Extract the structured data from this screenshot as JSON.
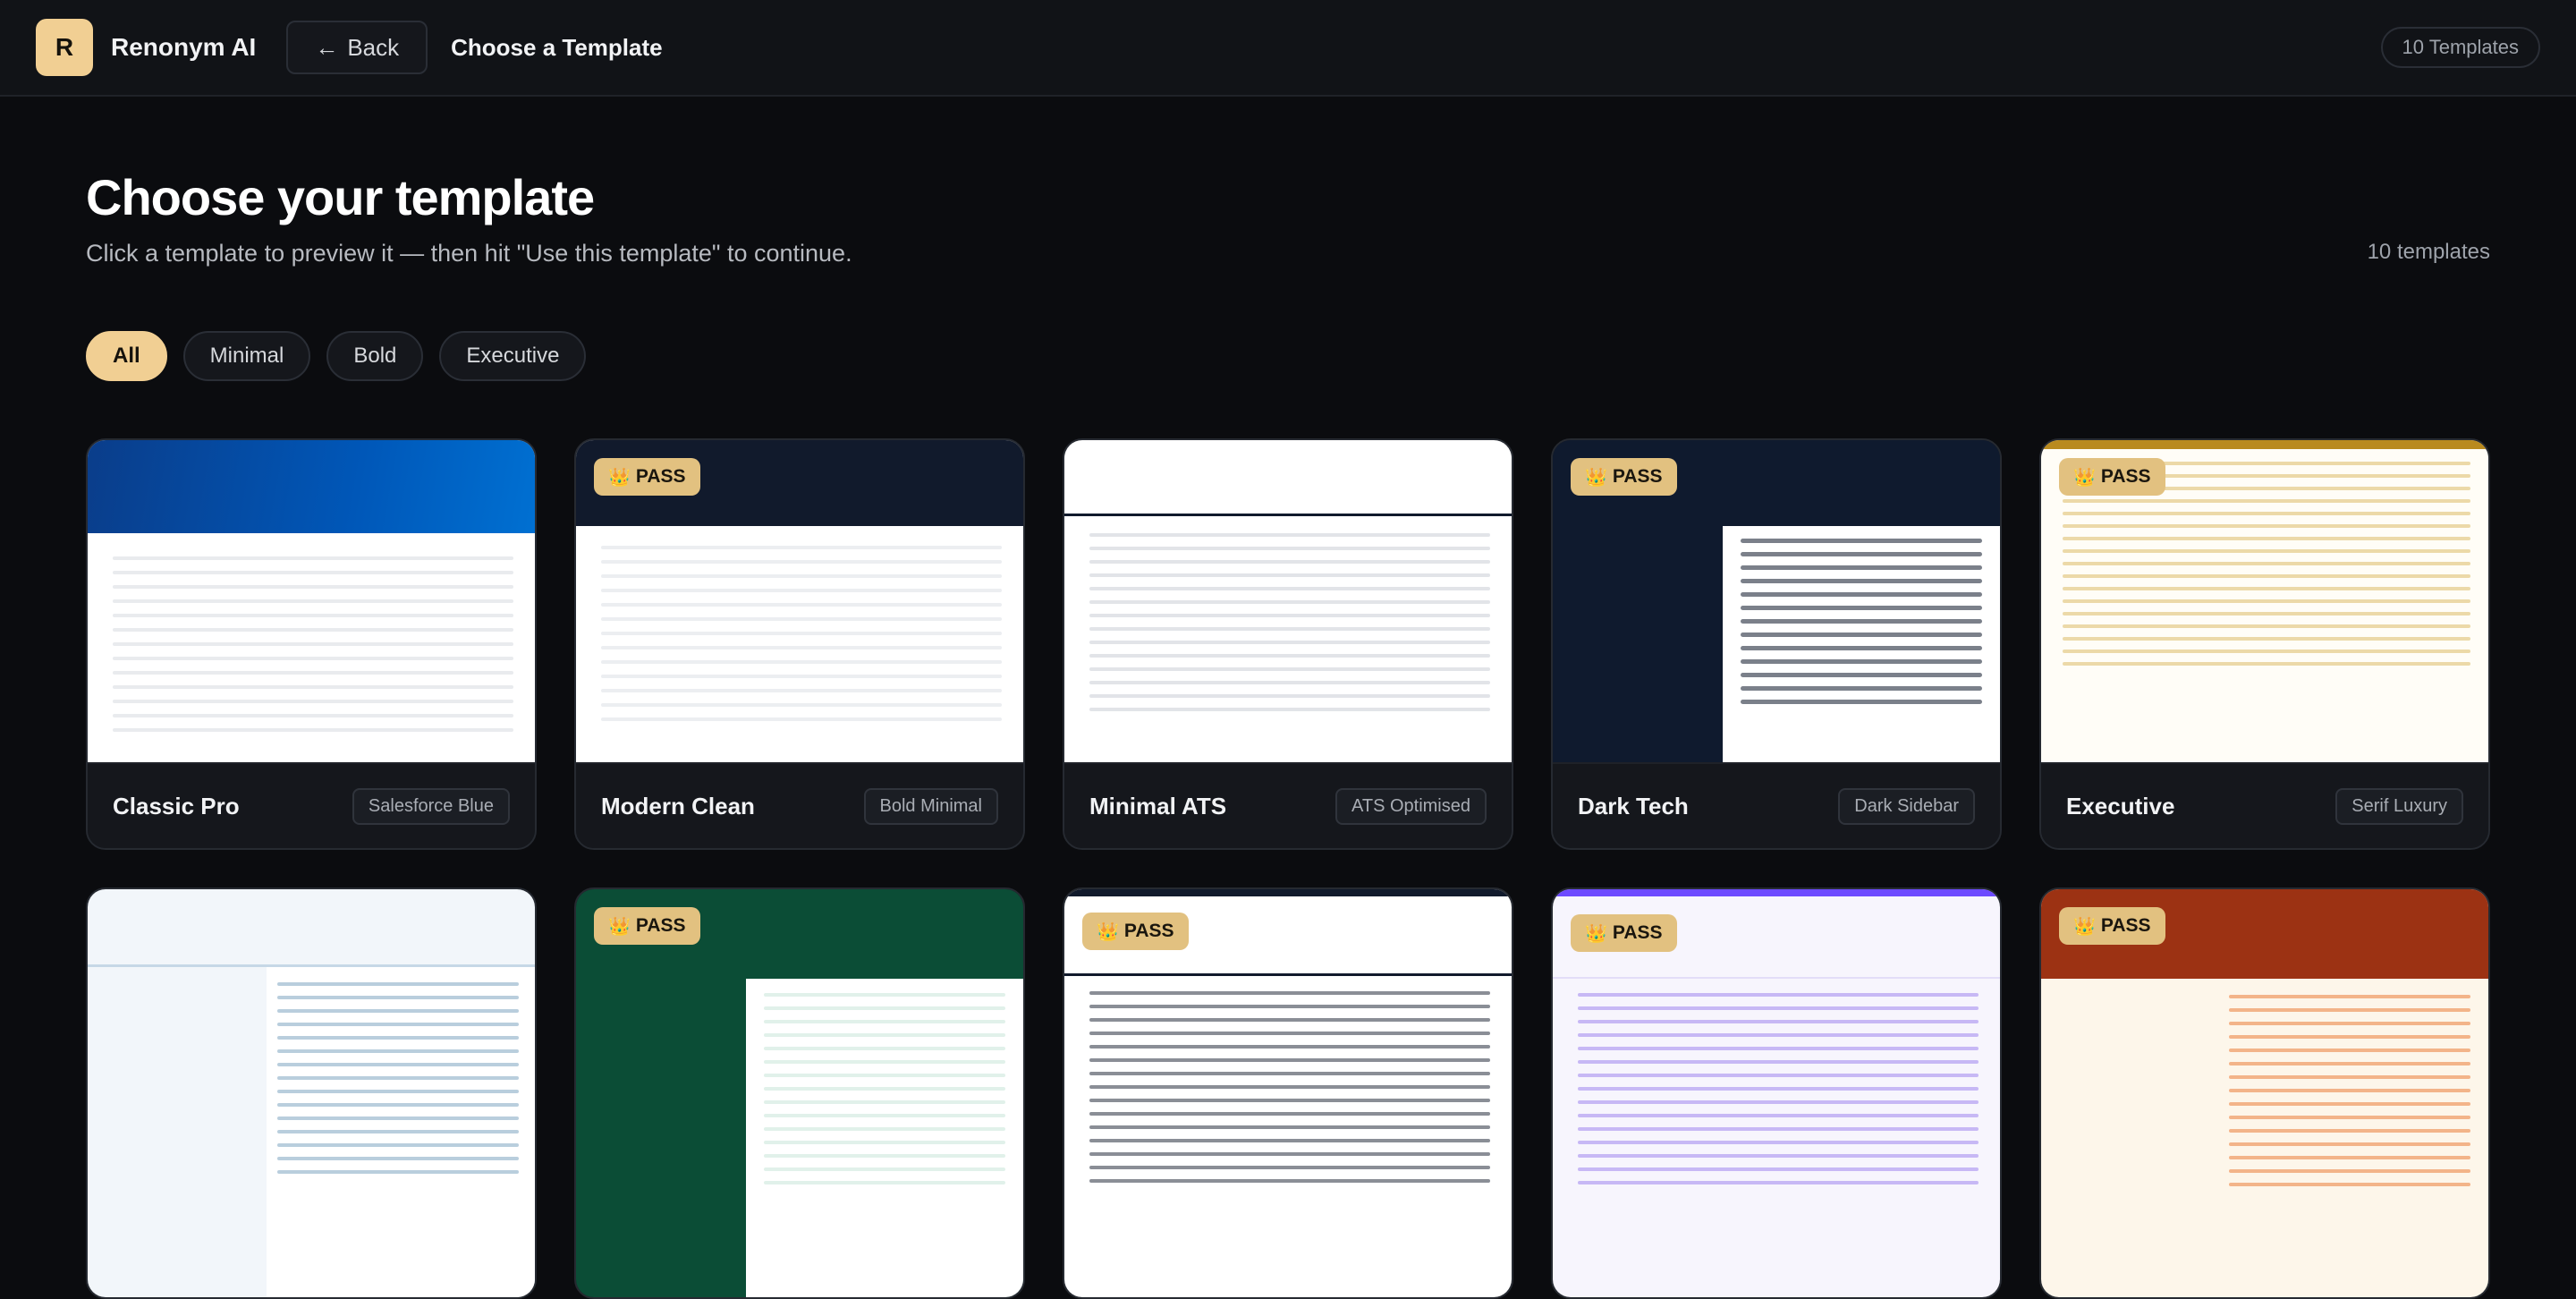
{
  "topbar": {
    "logo_letter": "R",
    "app_name": "Renonym AI",
    "back_label": "Back",
    "crumb": "Choose a Template",
    "count_pill": "10 Templates"
  },
  "header": {
    "title": "Choose your template",
    "subtitle": "Click a template to preview it — then hit \"Use this template\" to continue.",
    "count": "10 templates"
  },
  "filters": [
    "All",
    "Minimal",
    "Bold",
    "Executive"
  ],
  "badge_label": "PASS",
  "templates": [
    {
      "name": "Classic Pro",
      "tag": "Salesforce Blue",
      "pass": false
    },
    {
      "name": "Modern Clean",
      "tag": "Bold Minimal",
      "pass": true
    },
    {
      "name": "Minimal ATS",
      "tag": "ATS Optimised",
      "pass": false
    },
    {
      "name": "Dark Tech",
      "tag": "Dark Sidebar",
      "pass": true
    },
    {
      "name": "Executive",
      "tag": "Serif Luxury",
      "pass": true
    },
    {
      "name": "",
      "tag": "",
      "pass": false
    },
    {
      "name": "",
      "tag": "",
      "pass": true
    },
    {
      "name": "",
      "tag": "",
      "pass": true
    },
    {
      "name": "",
      "tag": "",
      "pass": true
    },
    {
      "name": "",
      "tag": "",
      "pass": true
    }
  ],
  "colors": {
    "accent": "#f1cf93",
    "background": "#0b0c0f",
    "card": "#15171c",
    "salesforce_blue": "#0070d2",
    "navy": "#0f1a2e",
    "green": "#0b4d36",
    "rust": "#9c3213",
    "violet": "#6d4aff",
    "gold": "#b98a1e"
  }
}
